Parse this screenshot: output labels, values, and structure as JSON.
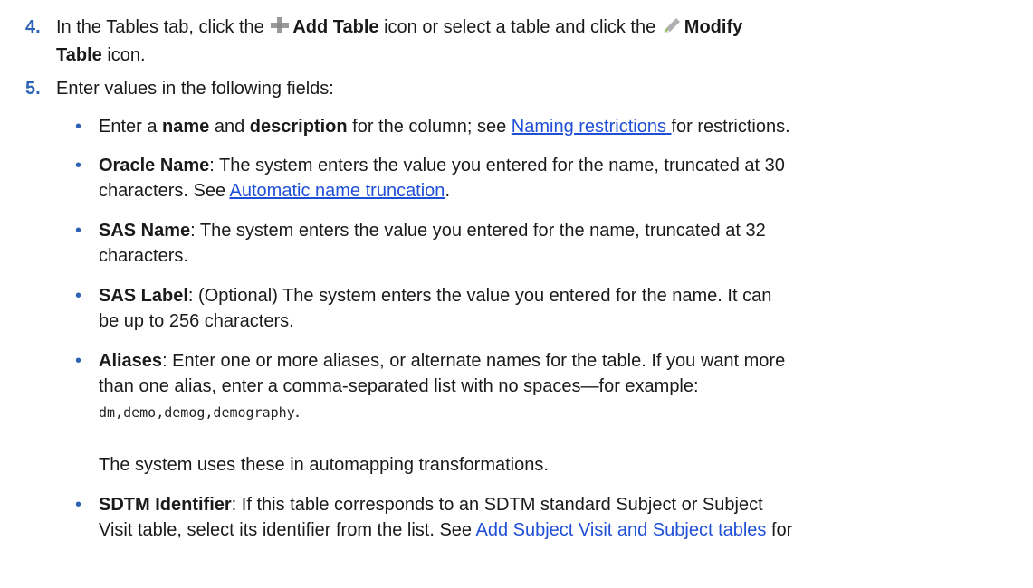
{
  "steps": [
    {
      "number": "4.",
      "t1": "In the Tables tab, click the ",
      "icon1": "add-table-icon",
      "b1": "Add Table",
      "t2": " icon or select a table and click the ",
      "icon2": "modify-table-icon",
      "b2": "Modify",
      "b3": "Table",
      "t3": " icon."
    },
    {
      "number": "5.",
      "text": "Enter values in the following fields:"
    }
  ],
  "bullets": {
    "name": {
      "t1": "Enter a ",
      "b1": "name",
      "t2": " and ",
      "b2": "description",
      "t3": " for the column; see ",
      "link": "Naming restrictions ",
      "t4": "for restrictions."
    },
    "oracle": {
      "label": "Oracle Name",
      "t1": ": The system enters the value you entered for the name, truncated at 30",
      "t2": "characters. See ",
      "link": "Automatic name truncation",
      "t3": "."
    },
    "sas_name": {
      "label": "SAS Name",
      "t1": ": The system enters the value you entered for the name, truncated at 32",
      "t2": "characters."
    },
    "sas_label": {
      "label": "SAS Label",
      "t1": ": (Optional) The system enters the value you entered for the name. It can",
      "t2": "be up to 256 characters."
    },
    "aliases": {
      "label": "Aliases",
      "t1": ": Enter one or more aliases, or alternate names for the table. If you want more",
      "t2": "than one alias, enter a comma-separated list with no spaces—for example:",
      "code": "dm,demo,demog,demography",
      "t3": ".",
      "note": "The system uses these in automapping transformations."
    },
    "sdtm": {
      "label": "SDTM Identifier",
      "t1": ": If this table corresponds to an SDTM standard Subject or Subject",
      "t2": "Visit table, select its identifier from the list. See ",
      "link": "Add Subject Visit and Subject tables",
      "t3": " for"
    }
  },
  "colors": {
    "number": "#2c63b5",
    "link": "#1f4fd6",
    "icon_gray": "#9a9a9a",
    "icon_green": "#7fbf3f"
  }
}
